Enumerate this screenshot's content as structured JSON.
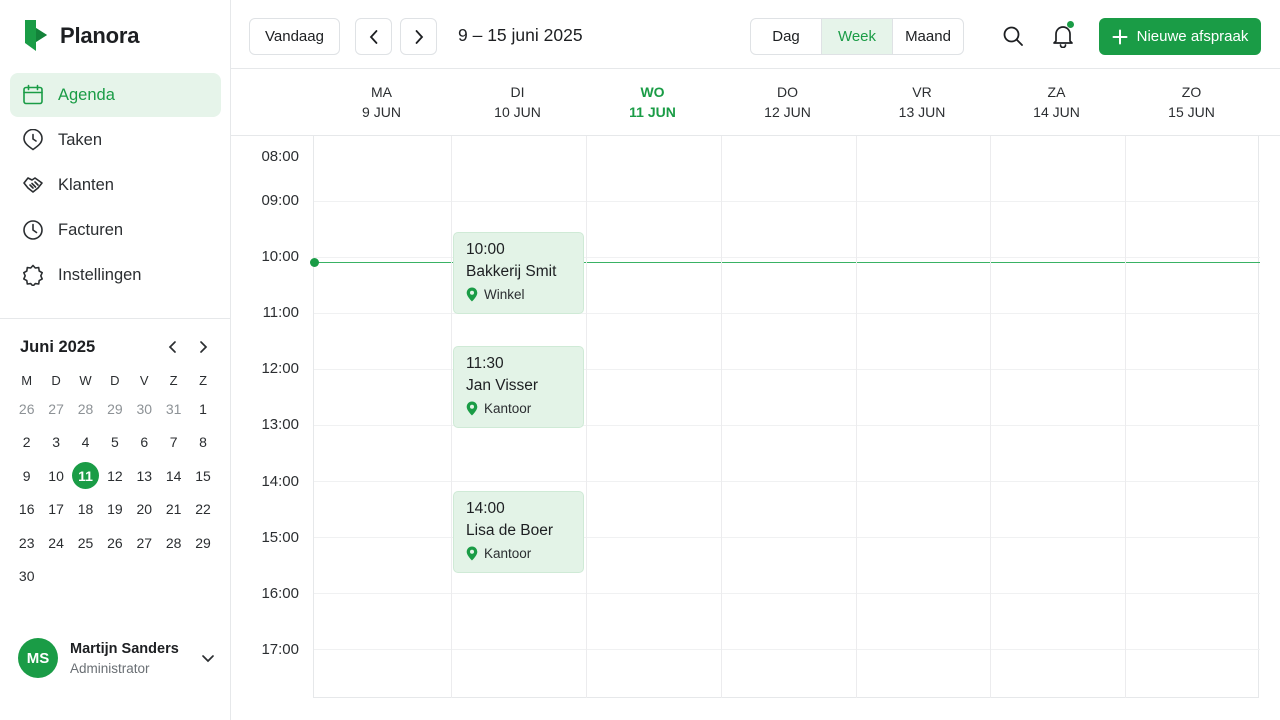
{
  "app": {
    "name": "Planora",
    "brand_color": "#1a9c46"
  },
  "sidebar": {
    "items": [
      {
        "label": "Agenda",
        "icon": "calendar-icon",
        "active": true
      },
      {
        "label": "Taken",
        "icon": "clock-check-icon",
        "active": false
      },
      {
        "label": "Klanten",
        "icon": "handshake-icon",
        "active": false
      },
      {
        "label": "Facturen",
        "icon": "clock-icon",
        "active": false
      },
      {
        "label": "Instellingen",
        "icon": "gear-icon",
        "active": false
      }
    ]
  },
  "mini_calendar": {
    "title": "Juni 2025",
    "weekdays": [
      "M",
      "D",
      "W",
      "D",
      "V",
      "Z",
      "Z"
    ],
    "leading_days": [
      "26",
      "27",
      "28",
      "29",
      "30",
      "31"
    ],
    "days": [
      "1",
      "2",
      "3",
      "4",
      "5",
      "6",
      "7",
      "8",
      "9",
      "10",
      "11",
      "12",
      "13",
      "14",
      "15",
      "16",
      "17",
      "18",
      "19",
      "20",
      "21",
      "22",
      "23",
      "24",
      "25",
      "26",
      "27",
      "28",
      "29",
      "30"
    ],
    "selected_day": "11"
  },
  "user": {
    "initials": "MS",
    "name": "Martijn Sanders",
    "role": "Administrator"
  },
  "toolbar": {
    "today_label": "Vandaag",
    "range_label": "9 – 15 juni 2025",
    "views": [
      {
        "label": "Dag",
        "active": false
      },
      {
        "label": "Week",
        "active": true
      },
      {
        "label": "Maand",
        "active": false
      }
    ],
    "new_label": "Nieuwe afspraak"
  },
  "calendar": {
    "days": [
      {
        "dow": "MA",
        "date": "9 JUN",
        "today": false
      },
      {
        "dow": "DI",
        "date": "10 JUN",
        "today": false
      },
      {
        "dow": "WO",
        "date": "11 JUN",
        "today": true
      },
      {
        "dow": "DO",
        "date": "12 JUN",
        "today": false
      },
      {
        "dow": "VR",
        "date": "13 JUN",
        "today": false
      },
      {
        "dow": "ZA",
        "date": "14 JUN",
        "today": false
      },
      {
        "dow": "ZO",
        "date": "15 JUN",
        "today": false
      }
    ],
    "hours": [
      "08:00",
      "09:00",
      "10:00",
      "11:00",
      "12:00",
      "13:00",
      "14:00",
      "15:00",
      "16:00",
      "17:00"
    ],
    "events": [
      {
        "time": "10:00",
        "title": "Bakkerij Smit",
        "location": "Winkel"
      },
      {
        "time": "11:30",
        "title": "Jan Visser",
        "location": "Kantoor"
      },
      {
        "time": "14:00",
        "title": "Lisa de Boer",
        "location": "Kantoor"
      }
    ]
  }
}
